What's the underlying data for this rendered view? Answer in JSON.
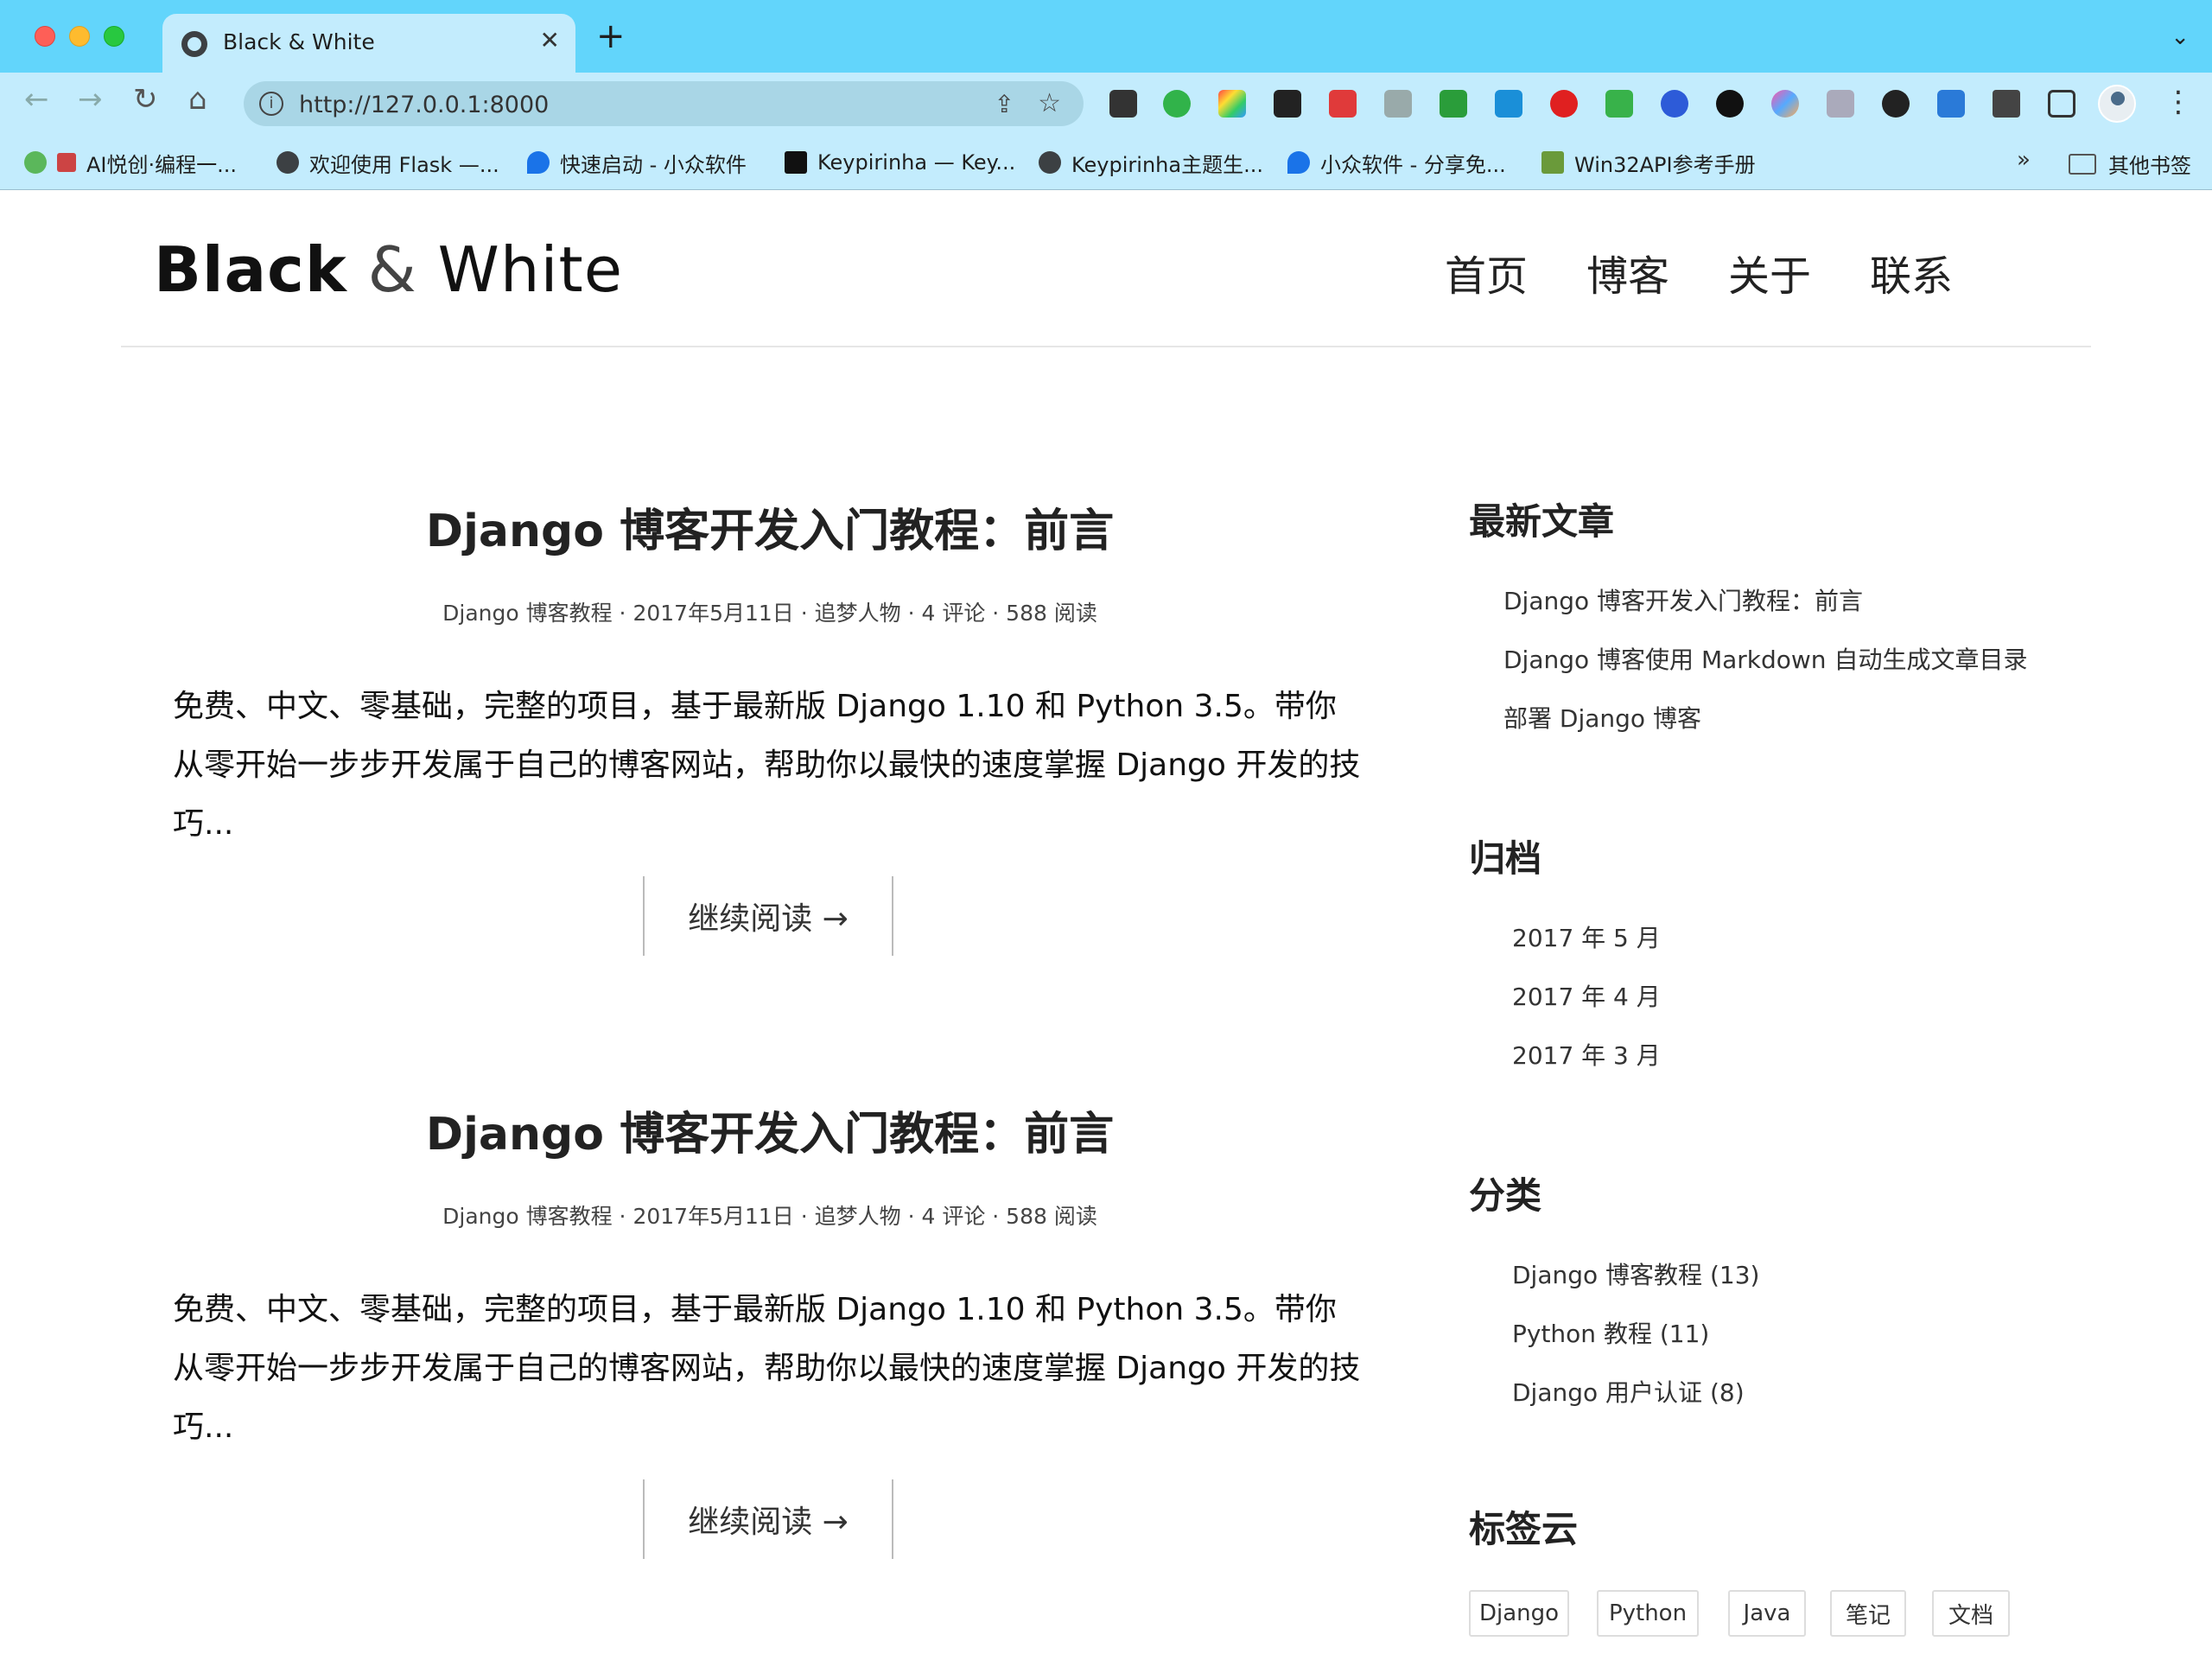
{
  "browser": {
    "tab_title": "Black & White",
    "tab_close": "✕",
    "new_tab": "+",
    "tab_menu": "⌄",
    "url": "http://127.0.0.1:8000",
    "bookmarks": [
      {
        "label": "AI悦创·编程一...",
        "icon_color": "#5bb75b"
      },
      {
        "label": "欢迎使用 Flask —...",
        "icon_color": "#3c4043"
      },
      {
        "label": "快速启动 - 小众软件",
        "icon_color": "#1a73e8"
      },
      {
        "label": "Keypirinha — Key...",
        "icon_color": "#111111"
      },
      {
        "label": "Keypirinha主题生...",
        "icon_color": "#3c4043"
      },
      {
        "label": "小众软件 - 分享免...",
        "icon_color": "#1a73e8"
      },
      {
        "label": "Win32API参考手册",
        "icon_color": "#6a9a3a"
      }
    ],
    "bookmarks_more": "»",
    "other_bookmarks": "其他书签"
  },
  "site": {
    "logo_bold": "Black",
    "logo_amp": " & ",
    "logo_rest": "White",
    "nav": [
      "首页",
      "博客",
      "关于",
      "联系"
    ]
  },
  "posts": [
    {
      "title": "Django 博客开发入门教程：前言",
      "meta": "Django 博客教程 · 2017年5月11日 · 追梦人物 · 4 评论 · 588 阅读",
      "excerpt": "免费、中文、零基础，完整的项目，基于最新版 Django 1.10 和 Python 3.5。带你从零开始一步步开发属于自己的博客网站，帮助你以最快的速度掌握 Django 开发的技巧...",
      "more": "继续阅读 →"
    },
    {
      "title": "Django 博客开发入门教程：前言",
      "meta": "Django 博客教程 · 2017年5月11日 · 追梦人物 · 4 评论 · 588 阅读",
      "excerpt": "免费、中文、零基础，完整的项目，基于最新版 Django 1.10 和 Python 3.5。带你从零开始一步步开发属于自己的博客网站，帮助你以最快的速度掌握 Django 开发的技巧...",
      "more": "继续阅读 →"
    }
  ],
  "sidebar": {
    "recent": {
      "title": "最新文章",
      "items": [
        "Django 博客开发入门教程：前言",
        "Django 博客使用 Markdown 自动生成文章目录",
        "部署 Django 博客"
      ]
    },
    "archive": {
      "title": "归档",
      "items": [
        "2017 年 5 月",
        "2017 年 4 月",
        "2017 年 3 月"
      ]
    },
    "categories": {
      "title": "分类",
      "items": [
        "Django 博客教程 (13)",
        "Python 教程 (11)",
        "Django 用户认证 (8)"
      ]
    },
    "tags": {
      "title": "标签云",
      "items": [
        "Django",
        "Python",
        "Java",
        "笔记",
        "文档"
      ]
    }
  }
}
